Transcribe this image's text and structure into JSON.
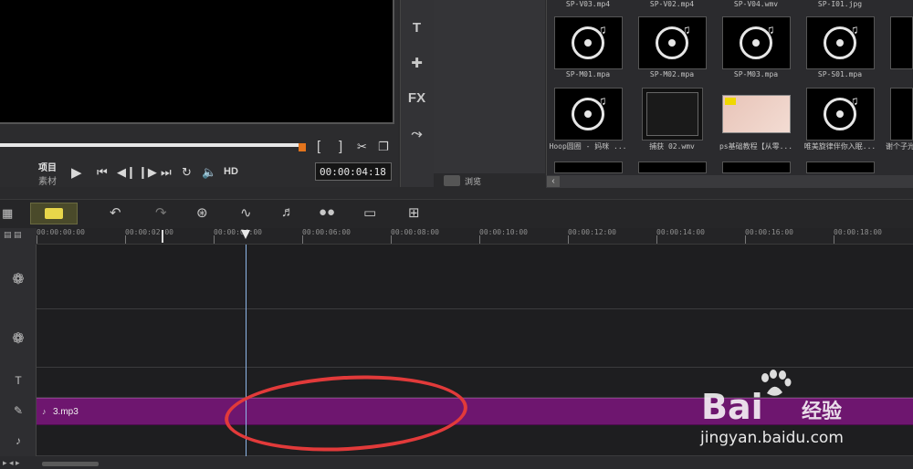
{
  "preview": {
    "mode_project": "项目",
    "mode_clip": "素材",
    "bracket_in": "[",
    "bracket_out": "]",
    "hd": "HD",
    "timecode": "00:00:04:18"
  },
  "tools": [
    "T",
    "FX"
  ],
  "library": {
    "browse_label": "浏览",
    "top_labels": [
      "SP-V03.mp4",
      "SP-V02.mp4",
      "SP-V04.wmv",
      "SP-I01.jpg"
    ],
    "row1": [
      "SP-M01.mpa",
      "SP-M02.mpa",
      "SP-M03.mpa",
      "SP-S01.mpa"
    ],
    "row2": [
      "Hoop圆圈 - 妈咪 ...",
      "捕获 02.wmv",
      "ps基础教程【从零...",
      "唯美旋律伴你入眠..."
    ],
    "row2_extra": "谢个子光"
  },
  "ruler": {
    "ticks": [
      "00:00:00:00",
      "00:00:02:00",
      "00:00:04:00",
      "00:00:06:00",
      "00:00:08:00",
      "00:00:10:00",
      "00:00:12:00",
      "00:00:14:00",
      "00:00:16:00",
      "00:00:18:00"
    ]
  },
  "tracks": {
    "music_clip": "3.mp3"
  },
  "watermark": {
    "brand": "Bai",
    "brand_cn": "经验",
    "url": "jingyan.baidu.com"
  }
}
